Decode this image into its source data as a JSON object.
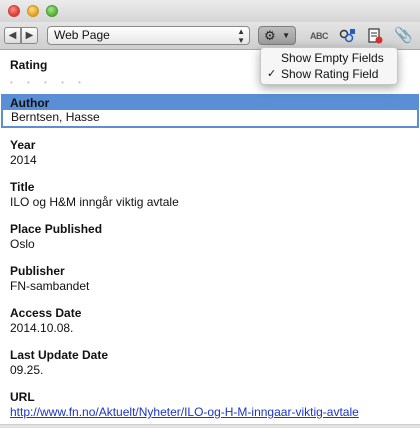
{
  "toolbar": {
    "item_type": "Web Page",
    "spell_label": "ABC"
  },
  "menu": {
    "items": [
      {
        "label": "Show Empty Fields",
        "checked": false
      },
      {
        "label": "Show Rating Field",
        "checked": true,
        "check_mark": "✓"
      }
    ]
  },
  "fields": {
    "rating": {
      "label": "Rating",
      "value": 0
    },
    "author": {
      "label": "Author",
      "value": "Berntsen, Hasse"
    },
    "year": {
      "label": "Year",
      "value": "2014"
    },
    "title": {
      "label": "Title",
      "value": "ILO og H&M inngår viktig avtale"
    },
    "place": {
      "label": "Place Published",
      "value": "Oslo"
    },
    "publisher": {
      "label": "Publisher",
      "value": "FN-sambandet"
    },
    "access_date": {
      "label": "Access Date",
      "value": "2014.10.08."
    },
    "last_update": {
      "label": "Last Update Date",
      "value": "09.25."
    },
    "url": {
      "label": "URL",
      "value": "http://www.fn.no/Aktuelt/Nyheter/ILO-og-H-M-inngaar-viktig-avtale"
    }
  },
  "colors": {
    "selection": "#5a8fd6",
    "link": "#1a35c7"
  }
}
